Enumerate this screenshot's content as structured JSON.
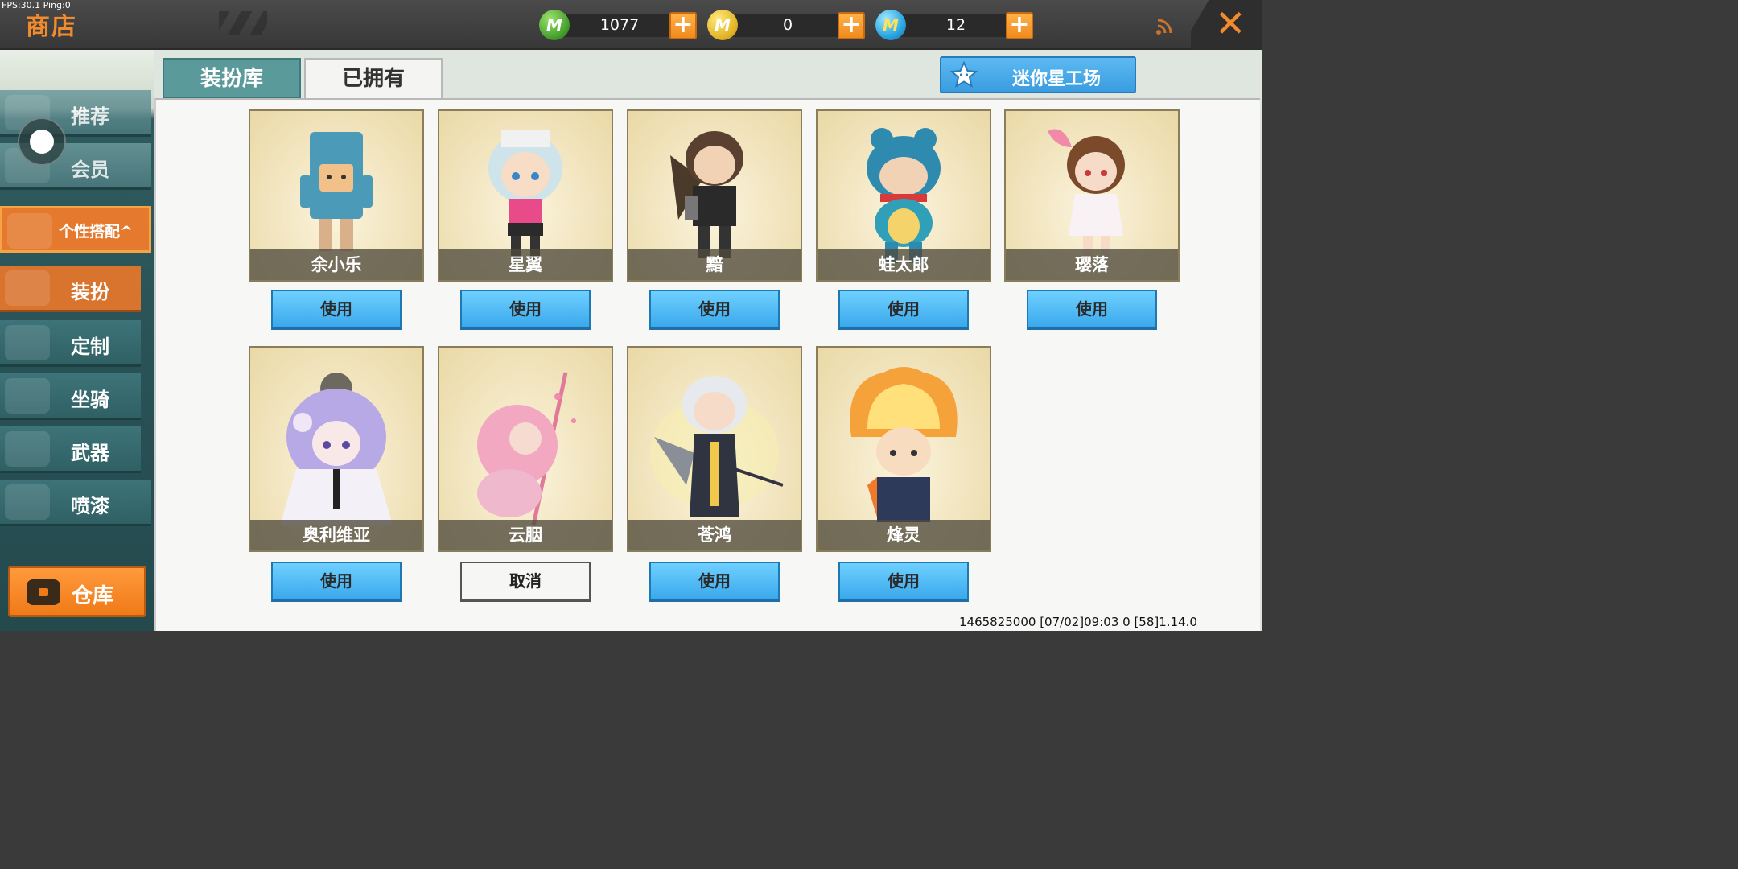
{
  "debug": {
    "fps_text": "FPS:30.1  Ping:0"
  },
  "header": {
    "title": "商店",
    "currencies": [
      {
        "icon": "green-mini-coin-icon",
        "value": "1077"
      },
      {
        "icon": "gold-mini-coin-icon",
        "value": "0"
      },
      {
        "icon": "blue-mini-coin-icon",
        "value": "12"
      }
    ],
    "plus_label": "+",
    "close_label": "✕"
  },
  "sidebar": {
    "items": [
      {
        "label": "推荐"
      },
      {
        "label": "会员"
      },
      {
        "label": "个性搭配^"
      },
      {
        "label": "装扮"
      },
      {
        "label": "定制"
      },
      {
        "label": "坐骑"
      },
      {
        "label": "武器"
      },
      {
        "label": "喷漆"
      }
    ],
    "warehouse_label": "仓库"
  },
  "tabs": [
    {
      "label": "装扮库"
    },
    {
      "label": "已拥有"
    }
  ],
  "mini_workshop_label": "迷你星工场",
  "skins": [
    {
      "name": "余小乐",
      "button": "使用"
    },
    {
      "name": "星翼",
      "button": "使用"
    },
    {
      "name": "黯",
      "button": "使用"
    },
    {
      "name": "蛙太郎",
      "button": "使用"
    },
    {
      "name": "璎落",
      "button": "使用"
    },
    {
      "name": "奥利维亚",
      "button": "使用"
    },
    {
      "name": "云胭",
      "button": "取消"
    },
    {
      "name": "苍鸿",
      "button": "使用"
    },
    {
      "name": "烽灵",
      "button": "使用"
    }
  ],
  "footer": {
    "info": "1465825000   [07/02]09:03 0 [58]1.14.0"
  },
  "colors": {
    "accent_orange": "#f28a2e",
    "button_blue": "#3aa9ec",
    "sidebar_teal": "#2f6064"
  }
}
